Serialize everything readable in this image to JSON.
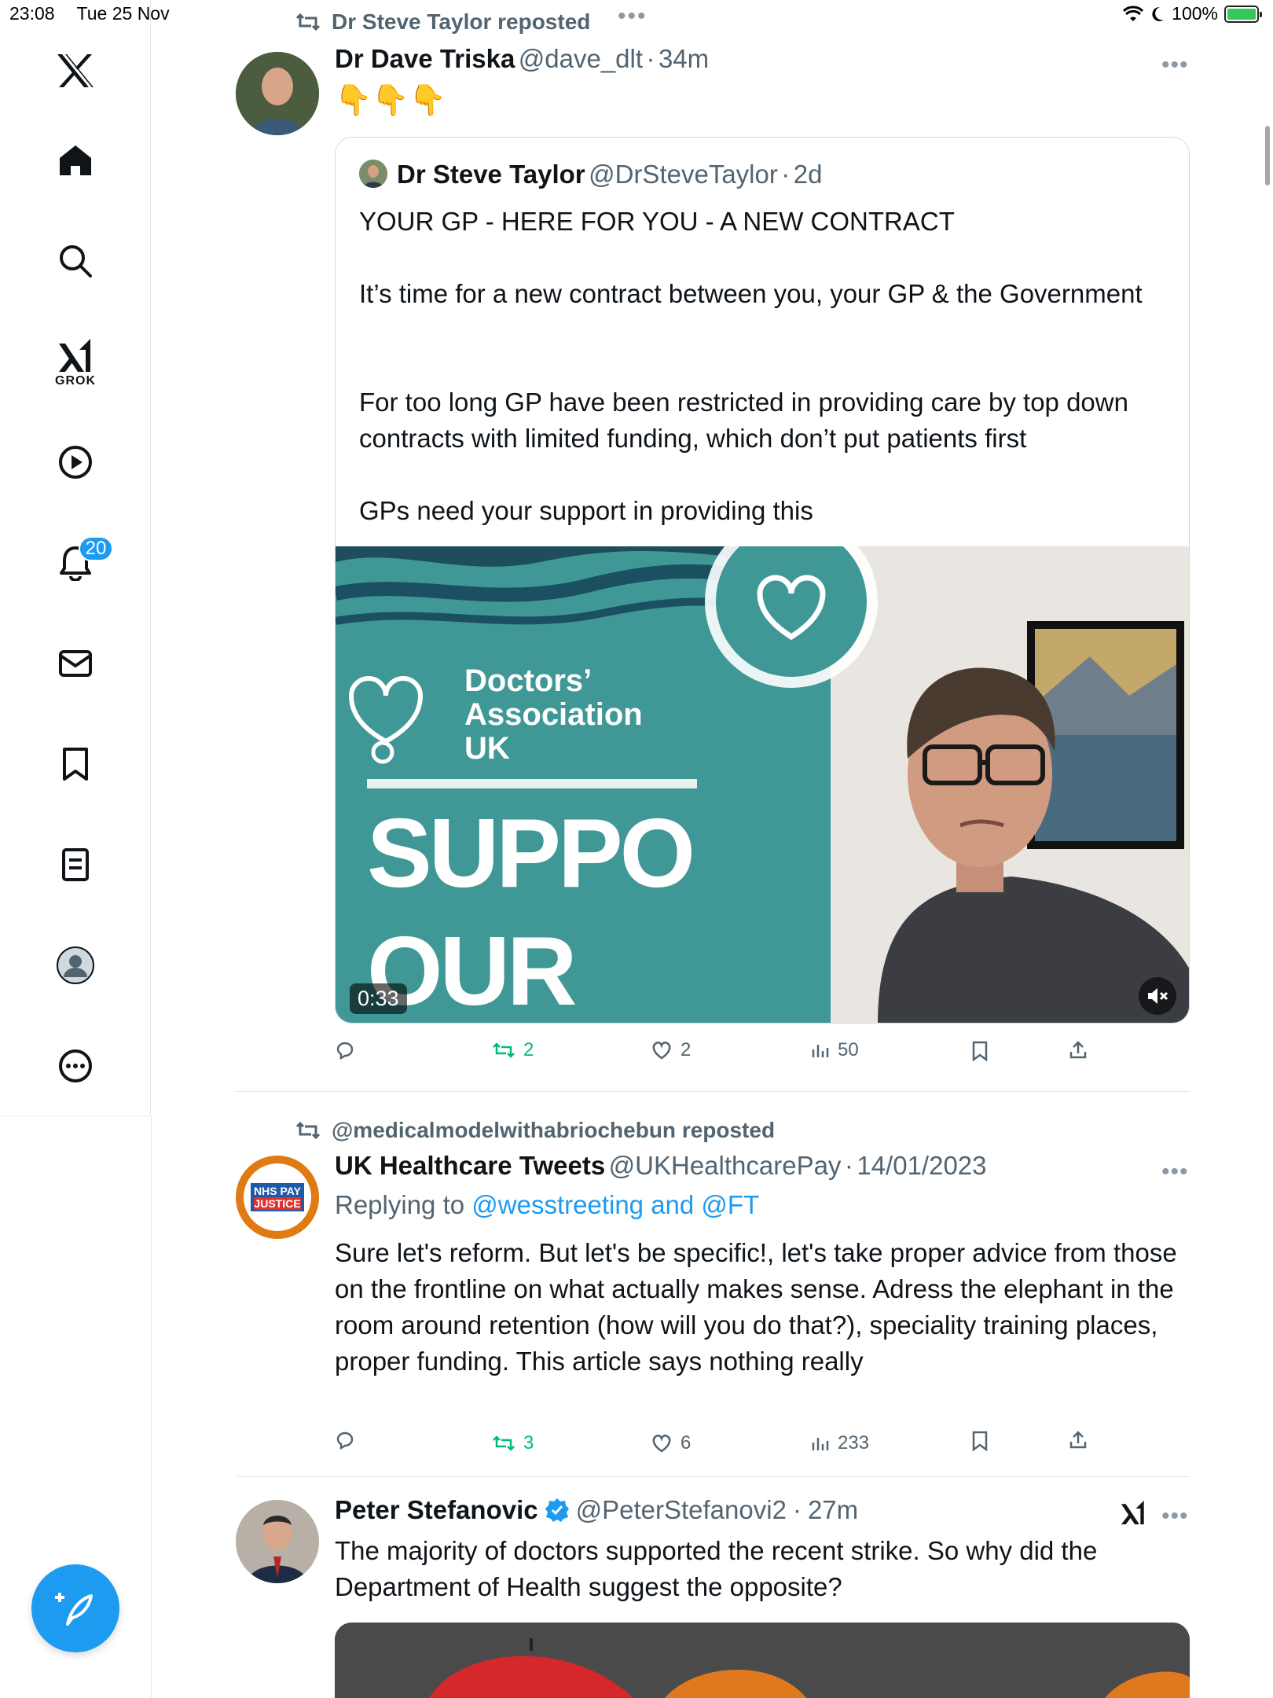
{
  "status_bar": {
    "time": "23:08",
    "date": "Tue 25 Nov",
    "battery": "100%"
  },
  "sidebar": {
    "grok_label": "GROK",
    "notifications_badge": "20"
  },
  "feed": {
    "tweet1": {
      "repost_label": "Dr Steve Taylor reposted",
      "name": "Dr Dave Triska",
      "handle": "@dave_dlt",
      "time": "34m",
      "text": "👇👇👇",
      "quote": {
        "name": "Dr Steve Taylor",
        "handle": "@DrSteveTaylor",
        "time": "2d",
        "para1": "YOUR GP - HERE FOR YOU - A NEW CONTRACT",
        "para2": "It’s time for a new contract between you, your GP & the Government",
        "para3": "For too long GP have been restricted in providing care by top down contracts with limited funding, which don’t put patients first",
        "para4": "GPs need your support in providing this",
        "video": {
          "duration": "0:33",
          "banner_line1": "Doctors’",
          "banner_line2": "Association",
          "banner_line3": "UK",
          "banner_big1": "SUPPO",
          "banner_big2": "OUR"
        }
      },
      "actions": {
        "retweets": "2",
        "likes": "2",
        "views": "50"
      }
    },
    "tweet2": {
      "repost_label": "@medicalmodelwithabriochebun reposted",
      "name": "UK Healthcare Tweets",
      "handle": "@UKHealthcarePay",
      "time": "14/01/2023",
      "replying_prefix": "Replying to",
      "replying_to": "@wesstreeting and @FT",
      "avatar_text1": "NHS PAY",
      "avatar_text2": "JUSTICE",
      "text": "Sure let's reform. But let's be specific!, let's take proper advice from those on the frontline on what actually makes sense. Adress the elephant in the room around retention (how will you do that?), speciality training places, proper funding. This article says nothing really",
      "actions": {
        "retweets": "3",
        "likes": "6",
        "views": "233"
      }
    },
    "tweet3": {
      "name": "Peter Stefanovic",
      "handle": "@PeterStefanovi2",
      "time": "27m",
      "text": "The majority of doctors supported the recent strike. So why did the Department of Health suggest the opposite?"
    }
  },
  "colors": {
    "accent": "#1d9bf0",
    "retweet_green": "#00ba7c",
    "secondary_text": "#536471"
  }
}
